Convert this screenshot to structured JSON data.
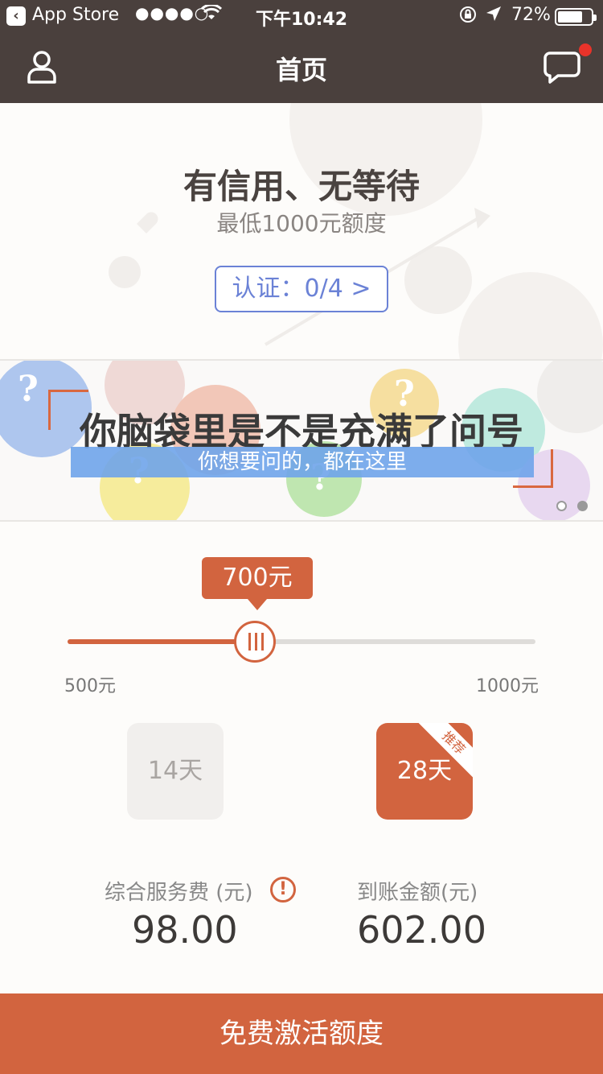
{
  "status_bar": {
    "back_app": "App Store",
    "signal": "●●●●○",
    "time": "下午10:42",
    "battery": "72%",
    "battery_level": 0.72
  },
  "nav": {
    "title": "首页"
  },
  "hero": {
    "title": "有信用、无等待",
    "subtitle": "最低1000元额度",
    "cert_button": "认证：0/4 >"
  },
  "banner": {
    "title": "你脑袋里是不是充满了问号",
    "subtitle": "你想要问的，都在这里",
    "pages": 2,
    "active_page": 2
  },
  "slider": {
    "min": 500,
    "max": 1000,
    "value": 700,
    "value_label": "700元",
    "min_label": "500元",
    "max_label": "1000元"
  },
  "terms": {
    "option1": "14天",
    "option2": "28天",
    "recommend": "推荐",
    "selected": 2
  },
  "fees": {
    "service_label": "综合服务费 (元)",
    "service_value": "98.00",
    "received_label": "到账金额(元)",
    "received_value": "602.00"
  },
  "cta": {
    "label": "免费激活额度"
  },
  "colors": {
    "accent": "#d2643f",
    "nav_bg": "#4a403d",
    "link_blue": "#6b82d6",
    "notification": "#e8332a"
  }
}
